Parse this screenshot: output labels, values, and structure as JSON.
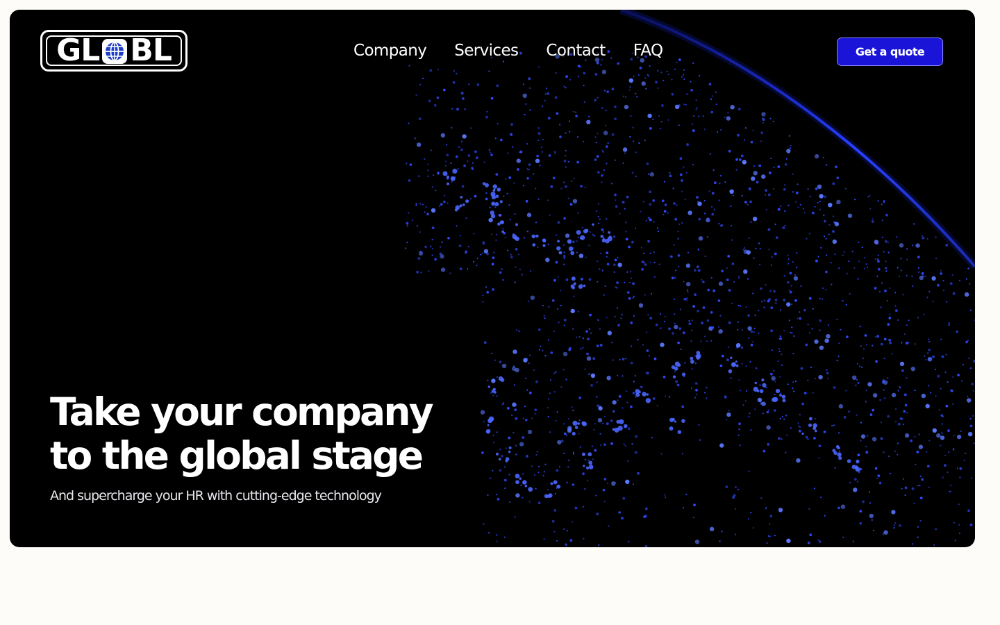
{
  "brand": {
    "logo_text_left": "GL",
    "logo_text_right": "BL",
    "logo_icon": "globe-icon",
    "accent_color": "#1a14d8",
    "city_light_color": "#2f4bff"
  },
  "nav": {
    "items": [
      {
        "label": "Company"
      },
      {
        "label": "Services"
      },
      {
        "label": "Contact"
      },
      {
        "label": "FAQ"
      }
    ],
    "cta_label": "Get a quote"
  },
  "hero": {
    "headline_line1": "Take your company",
    "headline_line2": "to the global stage",
    "subheadline": "And supercharge your HR with cutting-edge technology"
  }
}
